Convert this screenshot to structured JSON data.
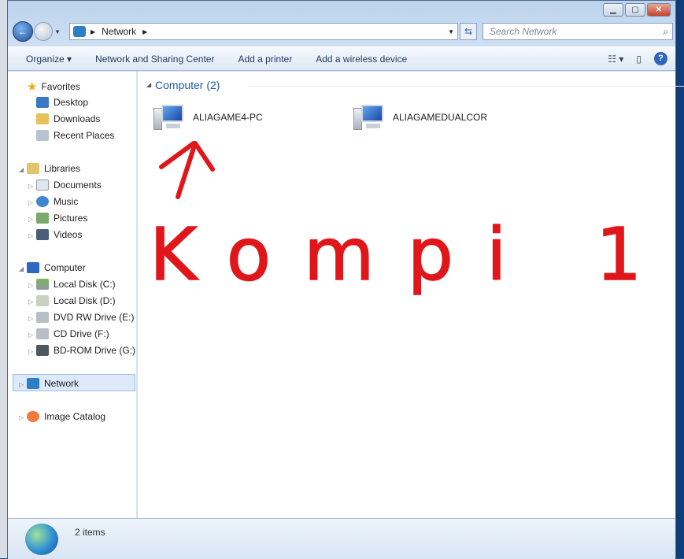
{
  "window": {
    "caption_buttons": [
      "minimize",
      "maximize",
      "close"
    ]
  },
  "address": {
    "path": [
      "Network"
    ],
    "search_placeholder": "Search Network"
  },
  "toolbar": {
    "organize": "Organize ▾",
    "items": [
      "Network and Sharing Center",
      "Add a printer",
      "Add a wireless device"
    ]
  },
  "sidebar": {
    "favorites": {
      "label": "Favorites",
      "items": [
        "Desktop",
        "Downloads",
        "Recent Places"
      ]
    },
    "libraries": {
      "label": "Libraries",
      "items": [
        "Documents",
        "Music",
        "Pictures",
        "Videos"
      ]
    },
    "computer": {
      "label": "Computer",
      "items": [
        "Local Disk (C:)",
        "Local Disk (D:)",
        "DVD RW Drive (E:)",
        "CD Drive (F:)",
        "BD-ROM Drive (G:) N"
      ]
    },
    "network": "Network",
    "image_catalog": "Image Catalog"
  },
  "main": {
    "group": "Computer (2)",
    "computers": [
      "ALIAGAME4-PC",
      "ALIAGAMEDUALCOR"
    ]
  },
  "annotation": {
    "handwritten_text": "Kompi 1",
    "color": "#e0161b"
  },
  "status": {
    "count": "2 items"
  }
}
